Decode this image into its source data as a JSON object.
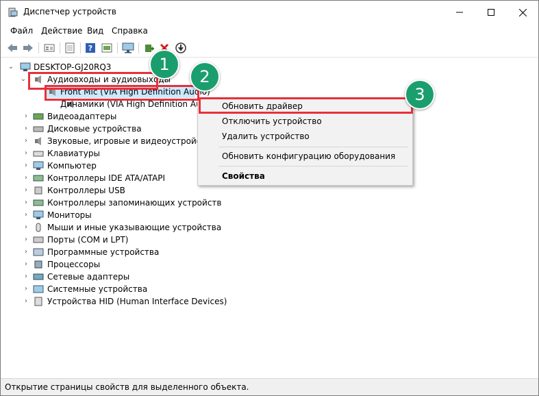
{
  "window": {
    "title": "Диспетчер устройств",
    "controls": {
      "minimize": "—",
      "maximize": "☐",
      "close": "✕"
    }
  },
  "menu": [
    "Файл",
    "Действие",
    "Вид",
    "Справка"
  ],
  "toolbar_icons": [
    "back-icon",
    "forward-icon",
    "show-hidden-icon",
    "properties-icon",
    "help-icon",
    "update-icon",
    "monitor-icon",
    "add-driver-icon",
    "uninstall-icon",
    "download-icon"
  ],
  "tree": {
    "root": "DESKTOP-GJ20RQ3",
    "audio_group": "Аудиовходы и аудиовыходы",
    "audio_children": [
      "Front Mic (VIA High Definition Audio)",
      "Динамики (VIA High Definition Audio"
    ],
    "categories": [
      "Видеоадаптеры",
      "Дисковые устройства",
      "Звуковые, игровые и видеоустройства",
      "Клавиатуры",
      "Компьютер",
      "Контроллеры IDE ATA/ATAPI",
      "Контроллеры USB",
      "Контроллеры запоминающих устройств",
      "Мониторы",
      "Мыши и иные указывающие устройства",
      "Порты (COM и LPT)",
      "Программные устройства",
      "Процессоры",
      "Сетевые адаптеры",
      "Системные устройства",
      "Устройства HID (Human Interface Devices)"
    ]
  },
  "context_menu": {
    "update_driver": "Обновить драйвер",
    "disable_device": "Отключить устройство",
    "uninstall_device": "Удалить устройство",
    "scan_hardware": "Обновить конфигурацию оборудования",
    "properties": "Свойства"
  },
  "badges": [
    "1",
    "2",
    "3"
  ],
  "status": "Открытие страницы свойств для выделенного объекта.",
  "colors": {
    "highlight_box": "#e8303a",
    "badge": "#1b9e6d"
  }
}
